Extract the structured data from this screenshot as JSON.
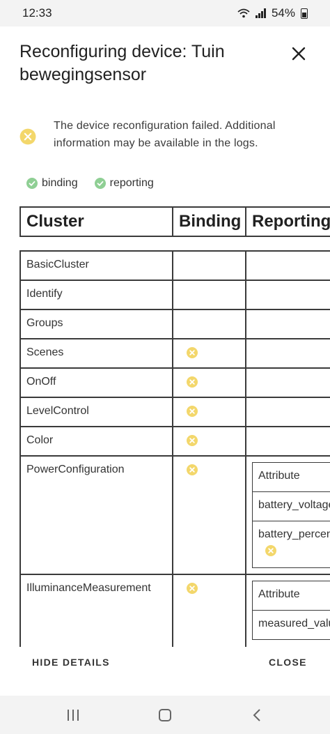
{
  "status_bar": {
    "time": "12:33",
    "battery": "54%"
  },
  "dialog": {
    "title": "Reconfiguring device: Tuin bewegingsensor",
    "message": "The device reconfiguration failed. Additional information may be available in the logs.",
    "legend": [
      {
        "label": "binding",
        "icon": "check-circle-icon"
      },
      {
        "label": "reporting",
        "icon": "check-circle-icon"
      }
    ],
    "table": {
      "headers": [
        "Cluster",
        "Binding",
        "Reporting"
      ],
      "rows": [
        {
          "cluster": "BasicCluster",
          "binding_failed": false
        },
        {
          "cluster": "Identify",
          "binding_failed": false
        },
        {
          "cluster": "Groups",
          "binding_failed": false
        },
        {
          "cluster": "Scenes",
          "binding_failed": true
        },
        {
          "cluster": "OnOff",
          "binding_failed": true
        },
        {
          "cluster": "LevelControl",
          "binding_failed": true
        },
        {
          "cluster": "Color",
          "binding_failed": true
        },
        {
          "cluster": "PowerConfiguration",
          "binding_failed": true,
          "reporting": {
            "header": "Attribute",
            "attributes": [
              "battery_voltage",
              "battery_percentage"
            ]
          }
        },
        {
          "cluster": "IlluminanceMeasurement",
          "binding_failed": true,
          "reporting": {
            "header": "Attribute",
            "attributes": [
              "measured_value"
            ]
          }
        }
      ]
    },
    "actions": {
      "hide_details": "HIDE DETAILS",
      "close": "CLOSE"
    }
  },
  "colors": {
    "warning": "#f3d76b",
    "success": "#8fcf94",
    "border": "#3a3a3a"
  }
}
